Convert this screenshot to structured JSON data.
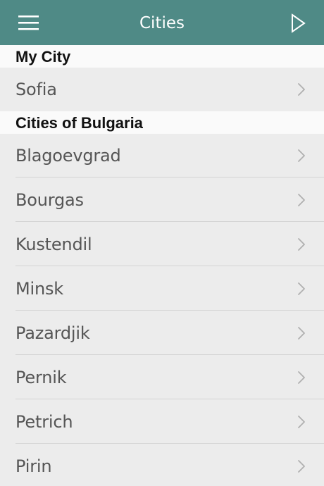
{
  "navbar": {
    "title": "Cities",
    "menu_icon": "hamburger-menu-icon",
    "action_icon": "play-triangle-icon",
    "background_color": "#4f8a86"
  },
  "sections": [
    {
      "header": "My City",
      "items": [
        {
          "label": "Sofia"
        }
      ]
    },
    {
      "header": "Cities of Bulgaria",
      "items": [
        {
          "label": "Blagoevgrad"
        },
        {
          "label": "Bourgas"
        },
        {
          "label": "Kustendil"
        },
        {
          "label": "Minsk"
        },
        {
          "label": "Pazardjik"
        },
        {
          "label": "Pernik"
        },
        {
          "label": "Petrich"
        },
        {
          "label": "Pirin"
        }
      ]
    }
  ],
  "row_chevron_icon": "chevron-right-icon"
}
